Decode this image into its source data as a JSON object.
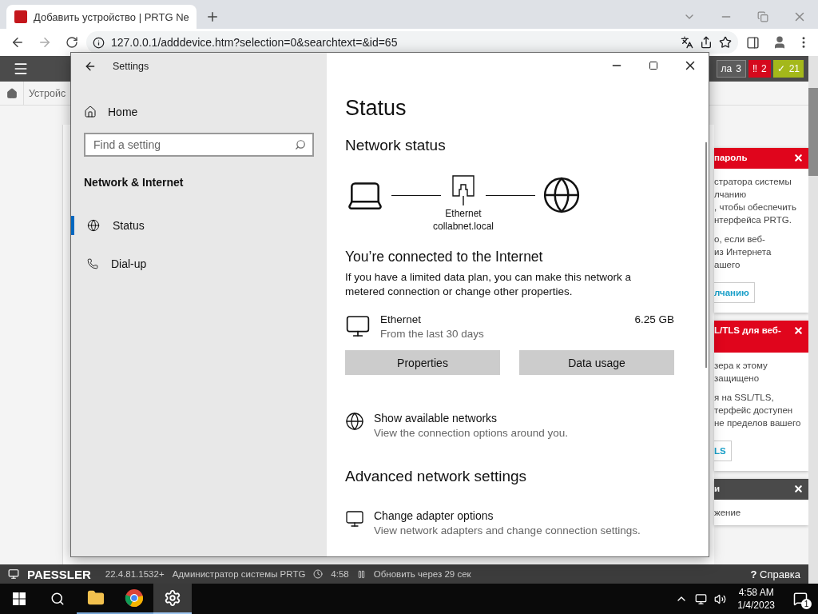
{
  "browser": {
    "tab": {
      "title": "Добавить устройство | PRTG Ne"
    },
    "address": "127.0.0.1/adddevice.htm?selection=0&searchtext=&id=65"
  },
  "prtg": {
    "badges": [
      {
        "kind": "neutral",
        "label": "ла",
        "count": "3"
      },
      {
        "kind": "error",
        "label": "‼",
        "count": "2"
      },
      {
        "kind": "ok",
        "label": "✓",
        "count": "21"
      }
    ],
    "breadcrumb": "Устройс",
    "notices": [
      {
        "kind": "error",
        "title": "пароль",
        "lines": [
          "стратора системы",
          "лчанию",
          ", чтобы обеспечить",
          "нтерфейса PRTG."
        ],
        "lines2": [
          "о, если веб-",
          "из Интернета",
          "ашего"
        ],
        "button": "лчанию"
      },
      {
        "kind": "error",
        "title": "L/TLS для веб-",
        "lines": [
          "зера к этому",
          "защищено"
        ],
        "lines2": [
          "я на SSL/TLS,",
          "терфейс доступен",
          "не пределов вашего"
        ],
        "button": "LS"
      },
      {
        "kind": "info",
        "title": "и",
        "lines": [
          "жение"
        ]
      }
    ],
    "footer": {
      "brand": "PAESSLER",
      "version": "22.4.81.1532+",
      "user": "Администратор системы PRTG",
      "time": "4:58",
      "refresh": "Обновить через 29 сек",
      "help_glyph": "?",
      "help": "Справка"
    }
  },
  "settings": {
    "title": "Settings",
    "home": "Home",
    "search": {
      "placeholder": "Find a setting"
    },
    "section": "Network & Internet",
    "nav": [
      {
        "kind": "status",
        "label": "Status",
        "selected": true
      },
      {
        "kind": "dialup",
        "label": "Dial-up",
        "selected": false
      }
    ],
    "page_title": "Status",
    "network_status": "Network status",
    "diagram": {
      "adapter": "Ethernet",
      "domain": "collabnet.local"
    },
    "connection": {
      "title": "You’re connected to the Internet",
      "description": "If you have a limited data plan, you can make this network a metered connection or change other properties."
    },
    "usage": {
      "name": "Ethernet",
      "period": "From the last 30 days",
      "amount": "6.25 GB"
    },
    "buttons": [
      "Properties",
      "Data usage"
    ],
    "links": [
      {
        "title": "Show available networks",
        "subtitle": "View the connection options around you."
      }
    ],
    "advanced_title": "Advanced network settings",
    "advanced_links": [
      {
        "title": "Change adapter options",
        "subtitle": "View network adapters and change connection settings."
      }
    ]
  },
  "taskbar": {
    "apps": [
      {
        "kind": "explorer",
        "selected": false
      },
      {
        "kind": "chrome",
        "selected": false
      },
      {
        "kind": "settings",
        "selected": true
      }
    ],
    "time": "4:58 AM",
    "date": "1/4/2023",
    "notifications": "1"
  }
}
